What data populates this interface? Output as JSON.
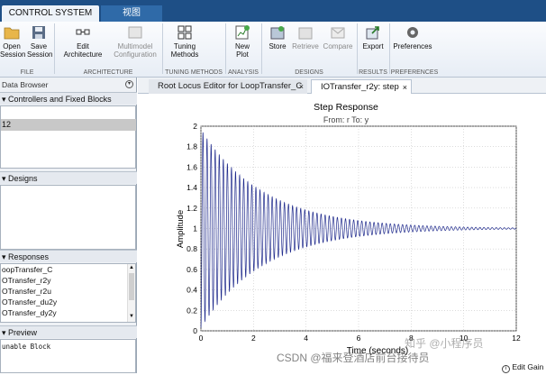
{
  "tabs": {
    "active": "CONTROL SYSTEM",
    "inactive": "视图"
  },
  "ribbon": {
    "open_l1": "Open",
    "open_l2": "Session",
    "save_l1": "Save",
    "save_l2": "Session",
    "edit_l1": "Edit",
    "edit_l2": "Architecture",
    "multi_l1": "Multimodel",
    "multi_l2": "Configuration",
    "tuning_l1": "Tuning",
    "tuning_l2": "Methods",
    "newplot_l1": "New",
    "newplot_l2": "Plot",
    "store": "Store",
    "retrieve": "Retrieve",
    "compare": "Compare",
    "export": "Export",
    "preferences": "Preferences",
    "groups": {
      "file": "FILE",
      "architecture": "ARCHITECTURE",
      "tuning": "TUNING METHODS",
      "analysis": "ANALYSIS",
      "designs": "DESIGNS",
      "results": "RESULTS",
      "preferences": "PREFERENCES"
    }
  },
  "left": {
    "data_browser": "Data Browser",
    "controllers_header": "Controllers and Fixed Blocks",
    "selected_item": "12",
    "designs_header": "Designs",
    "responses_header": "Responses",
    "responses": [
      "oopTransfer_C",
      "OTransfer_r2y",
      "OTransfer_r2u",
      "OTransfer_du2y",
      "OTransfer_dy2y"
    ],
    "preview_header": "Preview",
    "preview_line": "unable Block"
  },
  "doc_tabs": {
    "tab1": "Root Locus Editor for LoopTransfer_C",
    "tab2": "IOTransfer_r2y: step"
  },
  "chart_data": {
    "type": "line",
    "title": "Step Response",
    "subtitle": "From: r  To: y",
    "xlabel": "Time (seconds)",
    "ylabel": "Amplitude",
    "xlim": [
      0,
      12
    ],
    "ylim": [
      0,
      2
    ],
    "xticks": [
      "0",
      "2",
      "4",
      "6",
      "8",
      "10",
      "12"
    ],
    "yticks": [
      "0",
      "0.2",
      "0.4",
      "0.6",
      "0.8",
      "1",
      "1.2",
      "1.4",
      "1.6",
      "1.8",
      "2"
    ],
    "series": [
      {
        "model": "damped-oscillation",
        "steady_state": 1,
        "initial_overshoot": 0.97,
        "decay_rate": 0.42,
        "oscillation_period": 0.155
      }
    ]
  },
  "colors": {
    "series": "#1f2a8c",
    "ribbon_tab": "#1e4f86"
  },
  "watermark": {
    "csdn": "CSDN @福来登酒店前台接待员",
    "zhihu": "知乎 @小程序员"
  },
  "footer_hint": "Edit Gain"
}
